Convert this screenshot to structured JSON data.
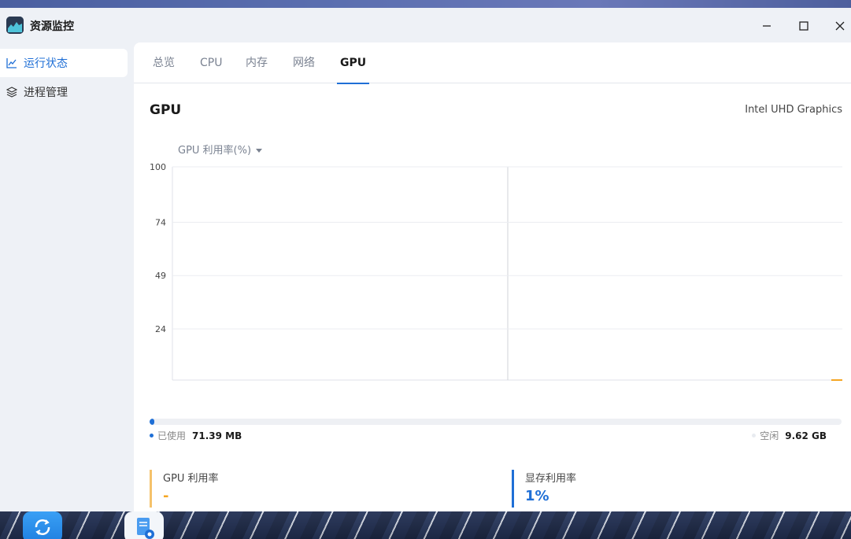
{
  "app": {
    "title": "资源监控"
  },
  "window_controls": {
    "minimize": "—",
    "maximize": "☐",
    "close": "✕"
  },
  "sidebar": {
    "items": [
      {
        "label": "运行状态",
        "icon": "line-chart-icon",
        "active": true
      },
      {
        "label": "进程管理",
        "icon": "layers-icon",
        "active": false
      }
    ]
  },
  "tabs": [
    {
      "label": "总览",
      "active": false
    },
    {
      "label": "CPU",
      "active": false
    },
    {
      "label": "内存",
      "active": false
    },
    {
      "label": "网络",
      "active": false
    },
    {
      "label": "GPU",
      "active": true
    }
  ],
  "section": {
    "title": "GPU",
    "gpu_name": "Intel UHD Graphics"
  },
  "metric_select": {
    "value": "GPU 利用率(%)"
  },
  "chart_data": {
    "type": "line",
    "title": "",
    "xlabel": "",
    "ylabel": "",
    "ylim": [
      0,
      100
    ],
    "yticks": [
      "100",
      "74",
      "49",
      "24"
    ],
    "grid": true,
    "series": [
      {
        "color": "#f5a623",
        "values": []
      }
    ]
  },
  "memory": {
    "used_label": "已使用",
    "used_value": "71.39 MB",
    "free_label": "空闲",
    "free_value": "9.62 GB",
    "used_fraction": 0.0072,
    "used_color": "#1f6fd6"
  },
  "stats": [
    {
      "label": "GPU 利用率",
      "value": "-",
      "color": "#f5c26b",
      "value_color": "#f5a623"
    },
    {
      "label": "显存利用率",
      "value": "1%",
      "color": "#1f6fd6",
      "value_color": "#1f6fd6"
    }
  ]
}
